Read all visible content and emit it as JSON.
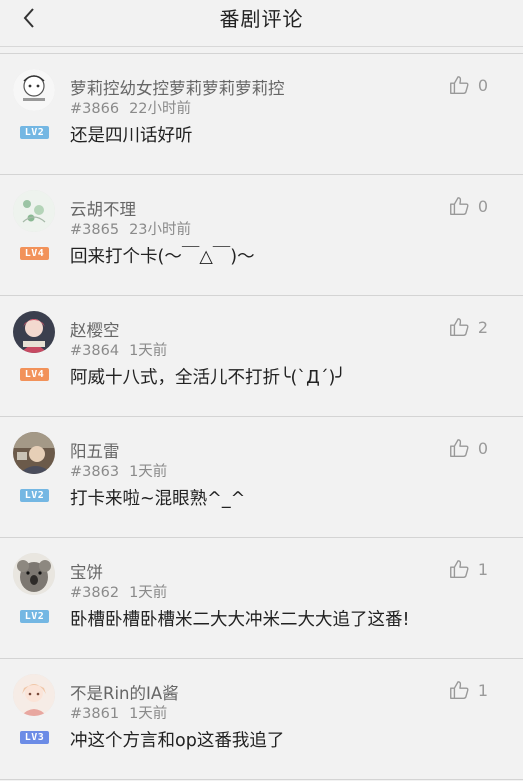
{
  "header": {
    "title": "番剧评论",
    "back_icon": "chevron-left-icon"
  },
  "colors": {
    "lv2": "#74b7e3",
    "lv3": "#6c8ce6",
    "lv4": "#f2925a",
    "text_muted": "#8a8a8a"
  },
  "comments": [
    {
      "name": "萝莉控幼女控萝莉萝莉萝莉控",
      "floor": "#3866",
      "time": "22小时前",
      "content": "还是四川话好听",
      "level": "LV2",
      "likes": "0"
    },
    {
      "name": "云胡不理",
      "floor": "#3865",
      "time": "23小时前",
      "content": "回来打个卡(～￣△￣)～",
      "level": "LV4",
      "likes": "0"
    },
    {
      "name": "赵樱空",
      "floor": "#3864",
      "time": "1天前",
      "content": "阿威十八式，全活儿不打折╰(`Д´)╯",
      "level": "LV4",
      "likes": "2"
    },
    {
      "name": "阳五雷",
      "floor": "#3863",
      "time": "1天前",
      "content": "打卡来啦~混眼熟^_^",
      "level": "LV2",
      "likes": "0"
    },
    {
      "name": "宝饼",
      "floor": "#3862",
      "time": "1天前",
      "content": "卧槽卧槽卧槽米二大大冲米二大大追了这番!",
      "level": "LV2",
      "likes": "1"
    },
    {
      "name": "不是Rin的IA酱",
      "floor": "#3861",
      "time": "1天前",
      "content": "冲这个方言和op这番我追了",
      "level": "LV3",
      "likes": "1"
    }
  ]
}
